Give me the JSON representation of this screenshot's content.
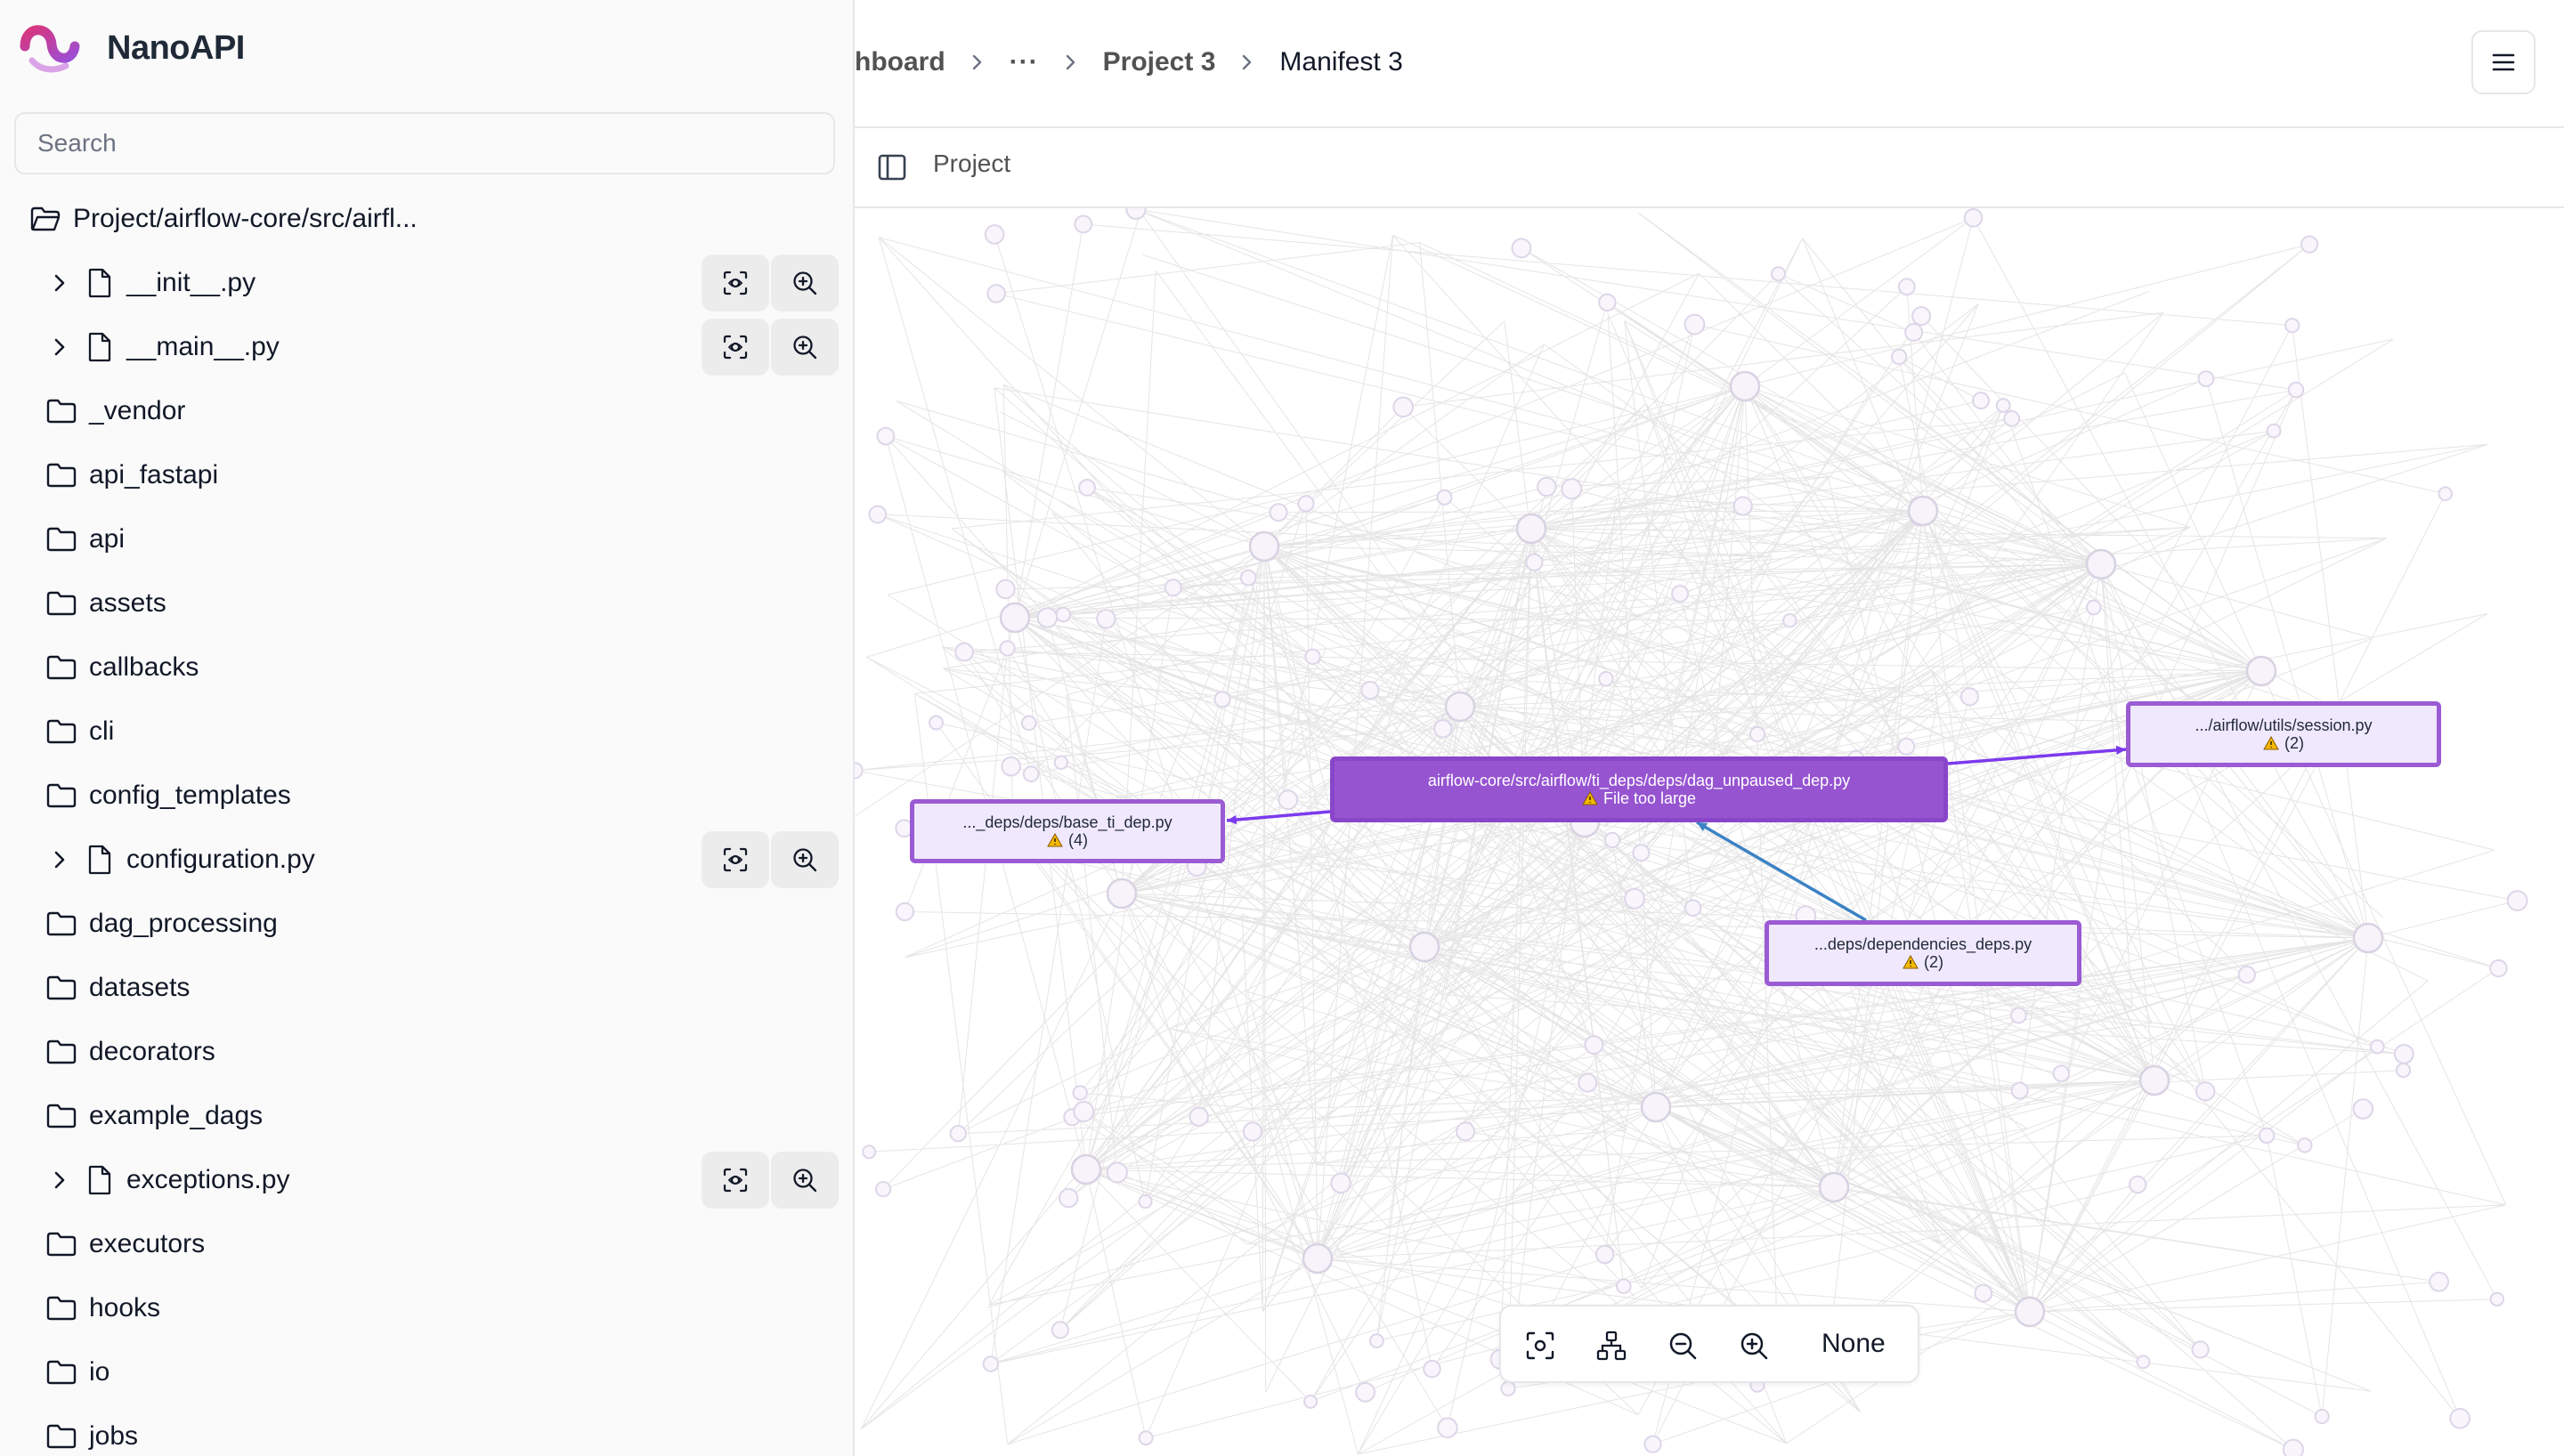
{
  "app": {
    "name": "NanoAPI"
  },
  "search": {
    "placeholder": "Search",
    "value": ""
  },
  "tree": {
    "root_label": "Project/airflow-core/src/airfl...",
    "items": [
      {
        "type": "file",
        "label": "__init__.py"
      },
      {
        "type": "file",
        "label": "__main__.py"
      },
      {
        "type": "folder",
        "label": "_vendor"
      },
      {
        "type": "folder",
        "label": "api_fastapi"
      },
      {
        "type": "folder",
        "label": "api"
      },
      {
        "type": "folder",
        "label": "assets"
      },
      {
        "type": "folder",
        "label": "callbacks"
      },
      {
        "type": "folder",
        "label": "cli"
      },
      {
        "type": "folder",
        "label": "config_templates"
      },
      {
        "type": "file",
        "label": "configuration.py"
      },
      {
        "type": "folder",
        "label": "dag_processing"
      },
      {
        "type": "folder",
        "label": "datasets"
      },
      {
        "type": "folder",
        "label": "decorators"
      },
      {
        "type": "folder",
        "label": "example_dags"
      },
      {
        "type": "file",
        "label": "exceptions.py"
      },
      {
        "type": "folder",
        "label": "executors"
      },
      {
        "type": "folder",
        "label": "hooks"
      },
      {
        "type": "folder",
        "label": "io"
      },
      {
        "type": "folder",
        "label": "jobs"
      }
    ]
  },
  "breadcrumb": {
    "items": [
      "hboard",
      "···",
      "Project 3",
      "Manifest 3"
    ]
  },
  "subheader": {
    "title": "Project"
  },
  "graph": {
    "nodes": [
      {
        "id": "selected",
        "line1": "airflow-core/src/airflow/ti_deps/deps/dag_unpaused_dep.py",
        "line2": "File too large",
        "selected": true
      },
      {
        "id": "base",
        "line1": "..._deps/deps/base_ti_dep.py",
        "line2": "(4)",
        "selected": false
      },
      {
        "id": "session",
        "line1": ".../airflow/utils/session.py",
        "line2": "(2)",
        "selected": false
      },
      {
        "id": "depdeps",
        "line1": "...deps/dependencies_deps.py",
        "line2": "(2)",
        "selected": false
      }
    ]
  },
  "toolbar": {
    "selection_label": "None"
  },
  "colors": {
    "accent": "#9654d1",
    "node_border": "#9b5bd4",
    "node_fill": "#f0e8fc",
    "edge_blue": "#3b82c4",
    "edge_purple": "#7c3aed",
    "warning": "#f5b800"
  },
  "icons": {
    "brand": "nanoapi-logo",
    "folder": "folder-icon",
    "file": "file-icon",
    "expand": "chevron-right-icon",
    "focus": "focus-icon",
    "zoom": "zoom-in-icon",
    "menu": "hamburger-menu-icon",
    "sidebar": "sidebar-toggle-icon",
    "layout": "hierarchy-icon",
    "zoom_out": "zoom-out-icon",
    "warning": "warning-icon"
  }
}
